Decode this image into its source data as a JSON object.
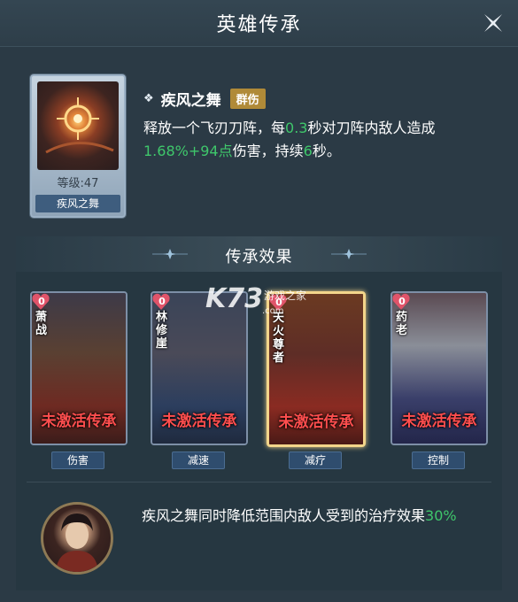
{
  "window": {
    "title": "英雄传承"
  },
  "icons": {
    "close": "close-x-icon",
    "bullet": "diamond-bullet-icon",
    "heart": "heart-icon"
  },
  "skill": {
    "card_level": "等级:47",
    "card_name": "疾风之舞",
    "name": "疾风之舞",
    "tag": "群伤",
    "desc": {
      "p1": "释放一个飞刃刀阵，每",
      "v1": "0.3",
      "p2": "秒对刀阵内敌人造成",
      "v2": "1.68%+94点",
      "p3": "伤害，持续",
      "v3": "6",
      "p4": "秒。"
    }
  },
  "effects": {
    "title": "传承效果",
    "heroes": [
      {
        "name": "萧战",
        "count": "0",
        "status": "未激活传承",
        "tag": "伤害"
      },
      {
        "name": "林修崖",
        "count": "0",
        "status": "未激活传承",
        "tag": "减速"
      },
      {
        "name": "天火尊者",
        "count": "0",
        "status": "未激活传承",
        "tag": "减疗",
        "selected": true
      },
      {
        "name": "药老",
        "count": "0",
        "status": "未激活传承",
        "tag": "控制"
      }
    ],
    "bonus": {
      "p1": "疾风之舞同时降低范围内敌人受到的治疗效果",
      "v1": "30%"
    }
  },
  "watermark": {
    "big": "K73",
    "small": "游戏之家",
    "com": ".com"
  },
  "colors": {
    "highlight": "#3fc76b",
    "inactive": "#ff4e4e",
    "tag_gold": "#b08a38",
    "selected_border": "#f3d58a"
  }
}
